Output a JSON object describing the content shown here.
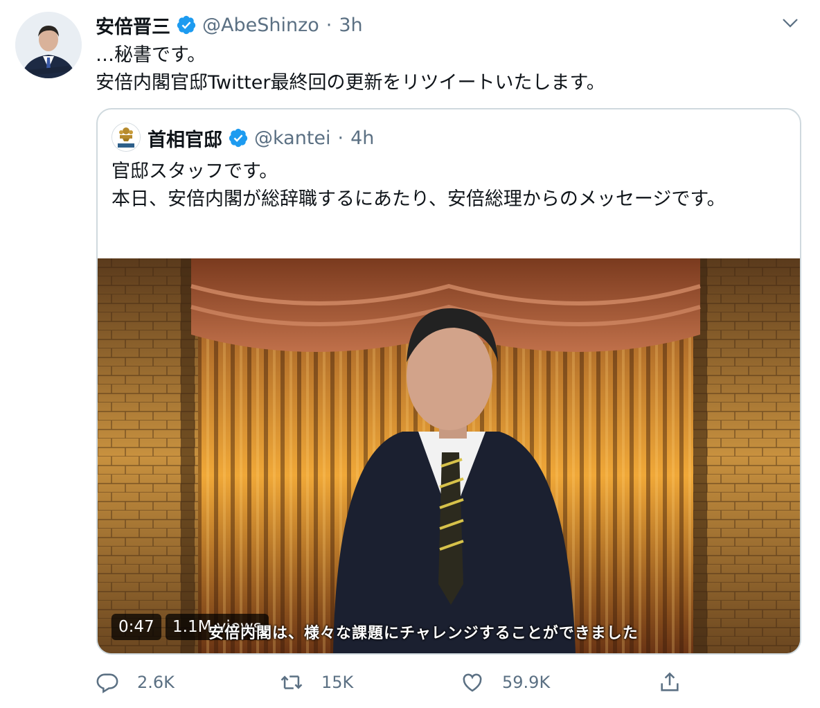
{
  "tweet": {
    "author_name": "安倍晋三",
    "handle": "@AbeShinzo",
    "separator": "·",
    "time": "3h",
    "verified": true,
    "lines": [
      "…秘書です。",
      "安倍内閣官邸Twitter最終回の更新をリツイートいたします。"
    ]
  },
  "quoted": {
    "author_name": "首相官邸",
    "handle": "@kantei",
    "separator": "·",
    "time": "4h",
    "verified": true,
    "lines": [
      "官邸スタッフです。",
      "本日、安倍内閣が総辞職するにあたり、安倍総理からのメッセージです。"
    ],
    "video": {
      "duration": "0:47",
      "views": "1.1M views",
      "subtitle": "安倍内閣は、様々な課題にチャレンジすることができました"
    }
  },
  "actions": {
    "replies": "2.6K",
    "retweets": "15K",
    "likes": "59.9K"
  },
  "colors": {
    "verified": "#1d9bf0",
    "secondary_text": "#5b7083",
    "border": "#cfd9de"
  },
  "icons": [
    "verified-badge-icon",
    "chevron-down-icon",
    "reply-icon",
    "retweet-icon",
    "like-icon",
    "share-icon"
  ]
}
